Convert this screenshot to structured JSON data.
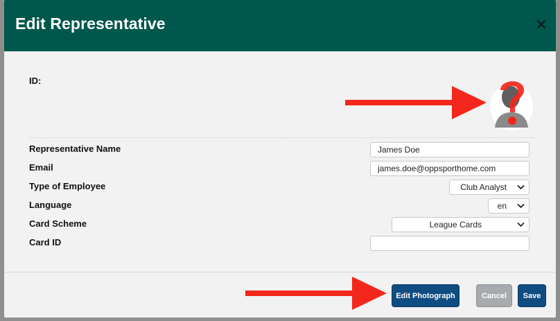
{
  "dialog": {
    "title": "Edit Representative"
  },
  "id_section": {
    "label": "ID:",
    "value": ""
  },
  "form": {
    "fields": [
      {
        "label": "Representative Name",
        "value": "James Doe"
      },
      {
        "label": "Email",
        "value": "james.doe@oppsporthome.com"
      },
      {
        "label": "Type of Employee",
        "value": "Club Analyst"
      },
      {
        "label": "Language",
        "value": "en"
      },
      {
        "label": "Card Scheme",
        "value": "League Cards"
      },
      {
        "label": "Card ID",
        "value": ""
      }
    ]
  },
  "footer": {
    "edit_photograph_label": "Edit Photograph",
    "cancel_label": "Cancel",
    "save_label": "Save"
  },
  "colors": {
    "header_bg": "#00574b",
    "primary_button": "#0f4c81",
    "secondary_button": "#a8abae",
    "annotation_arrow": "#f4271c",
    "avatar_question_mark": "#f4271c"
  },
  "icons": {
    "close": "close-icon",
    "avatar": "unknown-user-avatar-icon",
    "chevron": "chevron-down-icon",
    "arrow": "annotation-arrow-icon"
  }
}
